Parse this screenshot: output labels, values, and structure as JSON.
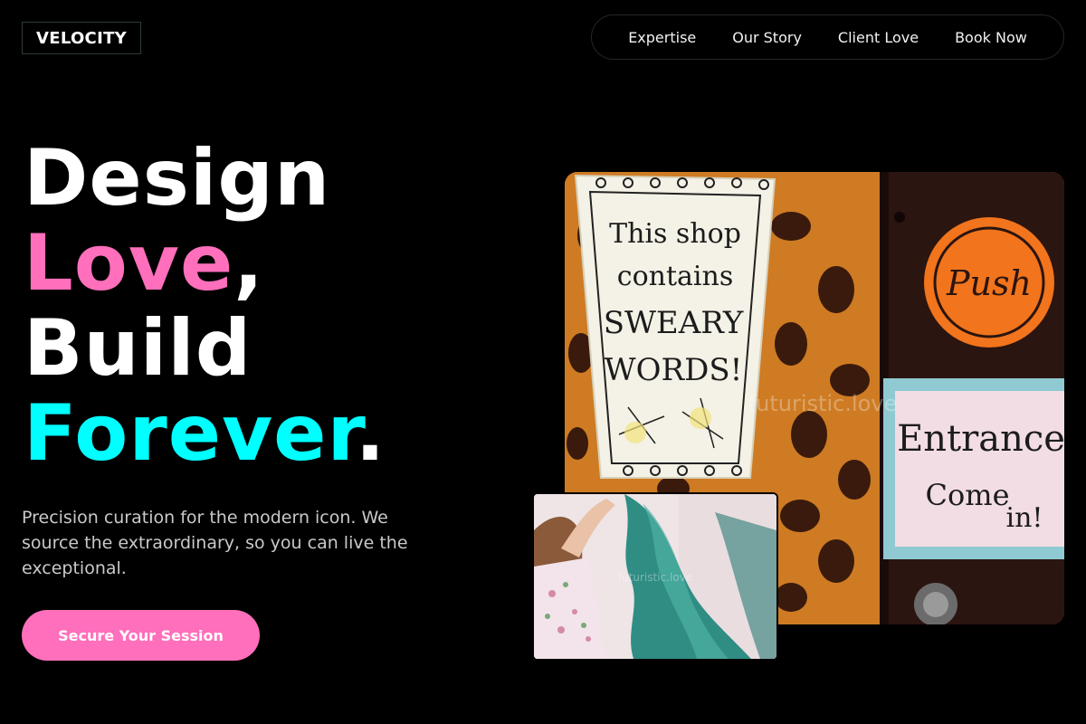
{
  "brand": {
    "logo_text": "VELOCITY"
  },
  "nav": {
    "items": [
      {
        "label": "Expertise"
      },
      {
        "label": "Our Story"
      },
      {
        "label": "Client Love"
      },
      {
        "label": "Book Now"
      }
    ]
  },
  "hero": {
    "headline": {
      "part1": "Design",
      "part2": "Love",
      "part2_suffix": ",",
      "part3": "Build",
      "part4": "Forever",
      "part4_suffix": "."
    },
    "subtext": "Precision curation for the modern icon. We source the extraordinary, so you can live the exceptional.",
    "cta_label": "Secure Your Session"
  },
  "images": {
    "main": {
      "sign_left": [
        "This shop",
        "contains",
        "SWEARY",
        "WORDS!"
      ],
      "push_label": "Push",
      "sign_right": [
        "Entrance",
        "Come",
        "in!"
      ],
      "watermark": "futuristic.love"
    },
    "inset": {
      "watermark": "futuristic.love"
    }
  },
  "colors": {
    "accent_pink": "#ff6fbb",
    "accent_cyan": "#00ffff",
    "background": "#000000"
  }
}
